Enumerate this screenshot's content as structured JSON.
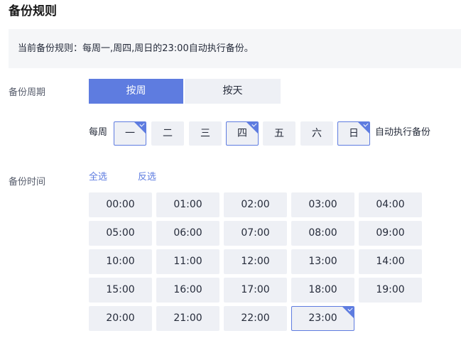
{
  "page": {
    "title": "备份规则"
  },
  "rule_banner": {
    "text": "当前备份规则：每周一,周四,周日的23:00自动执行备份。"
  },
  "cycle": {
    "label": "备份周期",
    "modes": [
      {
        "label": "按周",
        "selected": true
      },
      {
        "label": "按天",
        "selected": false
      }
    ],
    "week_prefix": "每周",
    "week_suffix": "自动执行备份",
    "days": [
      {
        "label": "一",
        "selected": true
      },
      {
        "label": "二",
        "selected": false
      },
      {
        "label": "三",
        "selected": false
      },
      {
        "label": "四",
        "selected": true
      },
      {
        "label": "五",
        "selected": false
      },
      {
        "label": "六",
        "selected": false
      },
      {
        "label": "日",
        "selected": true
      }
    ]
  },
  "time": {
    "label": "备份时间",
    "select_all": "全选",
    "invert": "反选",
    "slots": [
      {
        "label": "00:00",
        "selected": false
      },
      {
        "label": "01:00",
        "selected": false
      },
      {
        "label": "02:00",
        "selected": false
      },
      {
        "label": "03:00",
        "selected": false
      },
      {
        "label": "04:00",
        "selected": false
      },
      {
        "label": "05:00",
        "selected": false
      },
      {
        "label": "06:00",
        "selected": false
      },
      {
        "label": "07:00",
        "selected": false
      },
      {
        "label": "08:00",
        "selected": false
      },
      {
        "label": "09:00",
        "selected": false
      },
      {
        "label": "10:00",
        "selected": false
      },
      {
        "label": "11:00",
        "selected": false
      },
      {
        "label": "12:00",
        "selected": false
      },
      {
        "label": "13:00",
        "selected": false
      },
      {
        "label": "14:00",
        "selected": false
      },
      {
        "label": "15:00",
        "selected": false
      },
      {
        "label": "16:00",
        "selected": false
      },
      {
        "label": "17:00",
        "selected": false
      },
      {
        "label": "18:00",
        "selected": false
      },
      {
        "label": "19:00",
        "selected": false
      },
      {
        "label": "20:00",
        "selected": false
      },
      {
        "label": "21:00",
        "selected": false
      },
      {
        "label": "22:00",
        "selected": false
      },
      {
        "label": "23:00",
        "selected": true
      }
    ]
  },
  "colors": {
    "accent": "#5e7ce0",
    "chip_bg": "#eef0f5",
    "banner_bg": "#f5f6f8",
    "text": "#252b3a"
  }
}
